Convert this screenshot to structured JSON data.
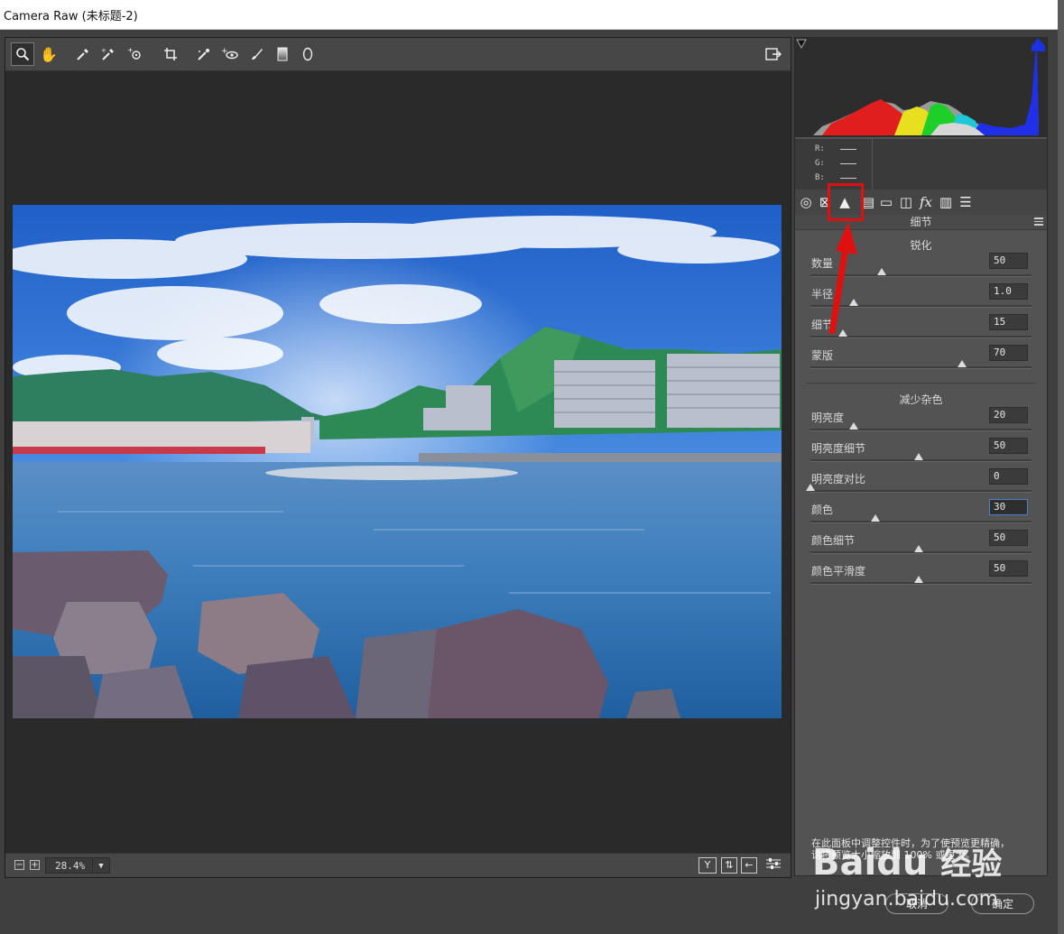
{
  "window": {
    "title": "Camera Raw (未标题-2)"
  },
  "toolbar": {
    "tools": [
      "zoom-tool",
      "hand-tool",
      "white-balance-tool",
      "color-sampler-tool",
      "targeted-adjustment-tool",
      "crop-tool",
      "spot-removal-tool",
      "red-eye-tool",
      "adjustment-brush",
      "graduated-filter",
      "radial-filter"
    ],
    "selected": "zoom-tool",
    "export_icon": "open-preferences-icon"
  },
  "bottom": {
    "zoom": "28.4%",
    "view_icons": [
      "Y",
      "before-after",
      "swap",
      "settings"
    ]
  },
  "histogram": {
    "rgb": {
      "r_label": "R:",
      "g_label": "G:",
      "b_label": "B:"
    }
  },
  "panel": {
    "tabs": [
      "basic",
      "tone-curve",
      "detail",
      "hsl",
      "split-toning",
      "lens-corrections",
      "effects",
      "camera-calibration",
      "presets"
    ],
    "active_tab": "detail",
    "section_title": "细节",
    "sharpening": {
      "title": "锐化",
      "sliders": [
        {
          "label": "数量",
          "value": "50",
          "pos": 0.33
        },
        {
          "label": "半径",
          "value": "1.0",
          "pos": 0.2
        },
        {
          "label": "细节",
          "value": "15",
          "pos": 0.15
        },
        {
          "label": "蒙版",
          "value": "70",
          "pos": 0.7
        }
      ]
    },
    "noise": {
      "title": "减少杂色",
      "sliders": [
        {
          "label": "明亮度",
          "value": "20",
          "pos": 0.2
        },
        {
          "label": "明亮度细节",
          "value": "50",
          "pos": 0.5
        },
        {
          "label": "明亮度对比",
          "value": "0",
          "pos": 0.0
        },
        {
          "label": "颜色",
          "value": "30",
          "pos": 0.3
        },
        {
          "label": "颜色细节",
          "value": "50",
          "pos": 0.5
        },
        {
          "label": "颜色平滑度",
          "value": "50",
          "pos": 0.5
        }
      ]
    },
    "info_line1": "在此面板中调整控件时，为了使预览更精确，",
    "info_line2": "请将预览大小缩放到 100% 或更大。"
  },
  "buttons": {
    "cancel": "取消",
    "done": "确定"
  },
  "watermark": {
    "brand": "Bai",
    "brand_mark": "du",
    "jingyan": "经验",
    "url": "jingyan.baidu.com"
  }
}
